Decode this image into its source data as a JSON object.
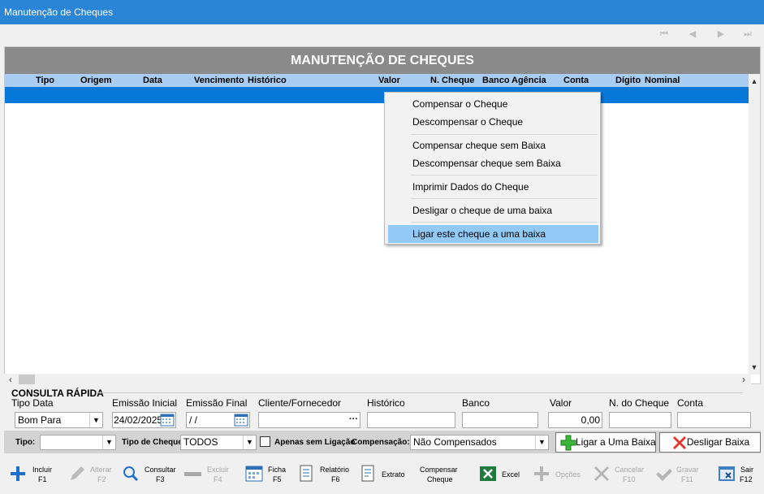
{
  "window": {
    "title": "Manutenção de Cheques"
  },
  "grid": {
    "title": "MANUTENÇÃO DE CHEQUES",
    "columns": [
      "Tipo",
      "Origem",
      "Data",
      "Vencimento",
      "Histórico",
      "Valor",
      "N. Cheque",
      "Banco",
      "Agência",
      "Conta",
      "Dígito",
      "Nominal"
    ]
  },
  "context_menu": {
    "items": [
      "Compensar o Cheque",
      "Descompensar o Cheque",
      "Compensar cheque sem Baixa",
      "Descompensar cheque sem Baixa",
      "Imprimir Dados do Cheque",
      "Desligar o cheque de uma baixa",
      "Ligar este cheque a uma baixa"
    ]
  },
  "consulta": {
    "legend": "CONSULTA RÁPIDA",
    "labels": {
      "tipo_data": "Tipo Data",
      "emissao_inicial": "Emissão Inicial",
      "emissao_final": "Emissão Final",
      "cliente": "Cliente/Fornecedor",
      "historico": "Histórico",
      "banco": "Banco",
      "valor": "Valor",
      "n_cheque": "N. do Cheque",
      "conta": "Conta"
    },
    "values": {
      "tipo_data": "Bom Para",
      "emissao_inicial": "24/02/2025",
      "emissao_final": " / /",
      "valor": "0,00"
    }
  },
  "filters": {
    "tipo_label": "Tipo:",
    "tipo_cheque_label": "Tipo de Cheque:",
    "tipo_cheque_value": "TODOS",
    "apenas_label": "Apenas sem Ligação",
    "compensacao_label": "Compensação:",
    "compensacao_value": "Não Compensados",
    "ligar_btn": "Ligar a Uma Baixa",
    "desligar_btn": "Desligar Baixa"
  },
  "toolbar": {
    "incluir": "Incluir",
    "incluir_key": "F1",
    "alterar": "Alterar",
    "alterar_key": "F2",
    "consultar": "Consultar",
    "consultar_key": "F3",
    "excluir": "Excluir",
    "excluir_key": "F4",
    "ficha": "Ficha",
    "ficha_key": "F5",
    "relatorio": "Relatório",
    "relatorio_key": "F6",
    "extrato": "Extrato",
    "compensar_1": "Compensar",
    "compensar_2": "Cheque",
    "excel": "Excel",
    "opcoes": "Opções",
    "cancelar": "Cancelar",
    "cancelar_key": "F10",
    "gravar": "Gravar",
    "gravar_key": "F11",
    "sair": "Sair",
    "sair_key": "F12"
  },
  "colors": {
    "titlebar": "#2b85d6",
    "grid_header": "#a9cdf0",
    "selection": "#0878d8",
    "menu_highlight": "#91c9f7"
  }
}
